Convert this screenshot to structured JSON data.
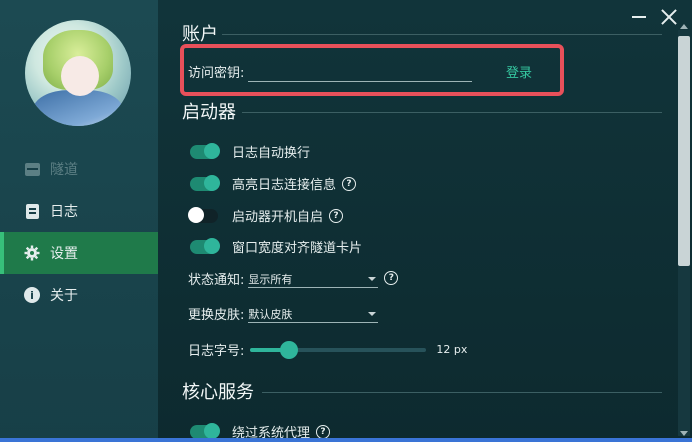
{
  "sidebar": {
    "items": [
      {
        "label": "隧道",
        "icon": "tunnel-icon",
        "state": "disabled"
      },
      {
        "label": "日志",
        "icon": "log-icon",
        "state": "normal"
      },
      {
        "label": "设置",
        "icon": "gear-icon",
        "state": "active"
      },
      {
        "label": "关于",
        "icon": "info-icon",
        "state": "normal"
      }
    ]
  },
  "window": {
    "minimize_icon": "minimize-icon",
    "close_icon": "close-icon"
  },
  "account": {
    "title": "账户",
    "key_label": "访问密钥:",
    "key_value": "",
    "login_label": "登录"
  },
  "launcher": {
    "title": "启动器",
    "toggles": [
      {
        "label": "日志自动换行",
        "on": true,
        "help": false
      },
      {
        "label": "高亮日志连接信息",
        "on": true,
        "help": true
      },
      {
        "label": "启动器开机自启",
        "on": false,
        "help": true
      },
      {
        "label": "窗口宽度对齐隧道卡片",
        "on": true,
        "help": false
      }
    ],
    "notify_label": "状态通知:",
    "notify_value": "显示所有",
    "skin_label": "更换皮肤:",
    "skin_value": "默认皮肤",
    "font_label": "日志字号:",
    "font_value": "12 px",
    "font_slider_fraction": 0.22
  },
  "core": {
    "title": "核心服务",
    "toggles": [
      {
        "label": "绕过系统代理",
        "on": true,
        "help": true
      }
    ]
  },
  "colors": {
    "accent": "#2fb59b",
    "active_nav": "#1f7a4a",
    "highlight_border": "#e8505a"
  }
}
